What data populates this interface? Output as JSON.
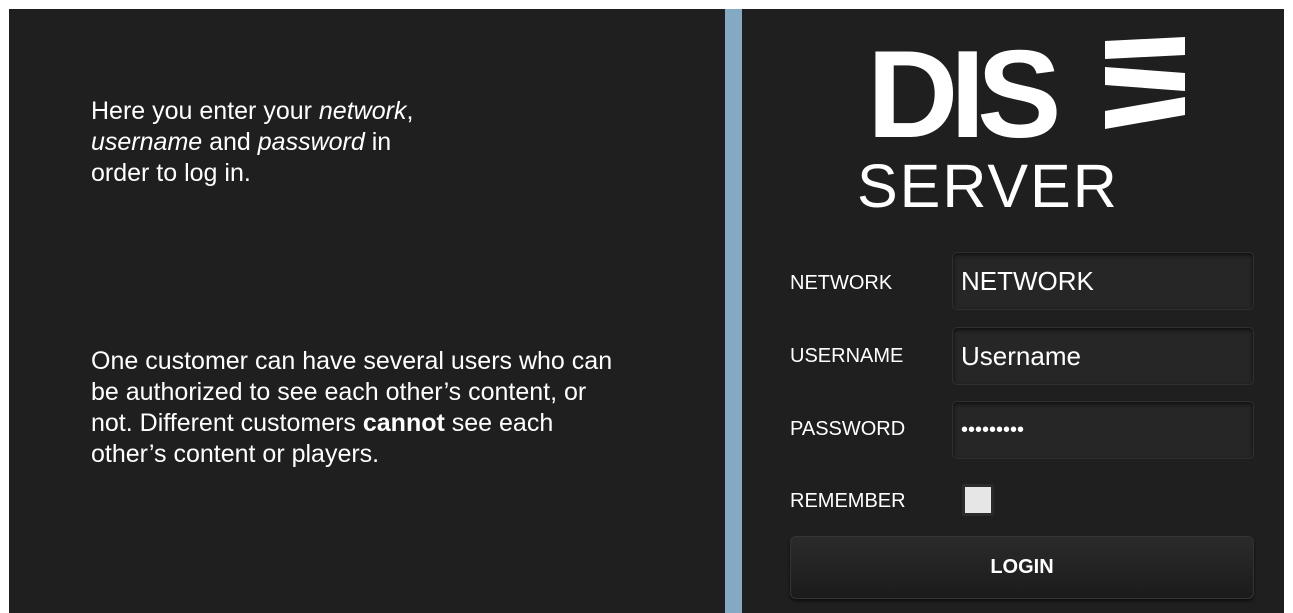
{
  "left": {
    "para1": {
      "t1": "Here you enter your ",
      "i1": "network",
      "t2": ",",
      "i2": "username",
      "t3": " and ",
      "i3": "password",
      "t4": " in",
      "t5": "order to log in."
    },
    "para2": {
      "t1": "One customer can have several users who can be authorized to see each other’s content, or not. Different customers ",
      "b1": "cannot",
      "t2": " see each other’s content or players."
    }
  },
  "logo": {
    "main": "DIS",
    "sub": "SERVER"
  },
  "form": {
    "network_label": "NETWORK",
    "network_value": "NETWORK",
    "username_label": "USERNAME",
    "username_value": "Username",
    "password_label": "PASSWORD",
    "password_value": "•••••••••",
    "remember_label": "REMEMBER",
    "remember_checked": false,
    "login_label": "LOGIN"
  },
  "colors": {
    "panel_bg": "#1f1f1f",
    "divider": "#85a8c3",
    "text": "#ffffff"
  }
}
